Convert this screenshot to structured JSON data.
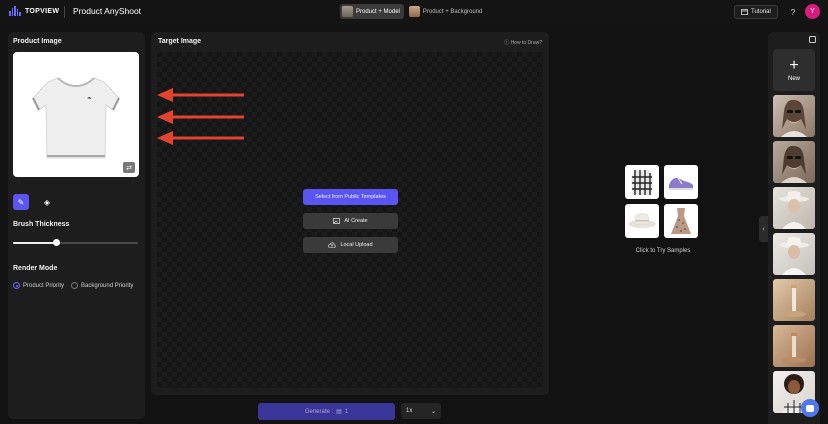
{
  "header": {
    "brand": "TOPVIEW",
    "app_title": "Product AnyShoot",
    "modes": [
      {
        "label": "Product + Model",
        "active": true
      },
      {
        "label": "Product + Background",
        "active": false
      }
    ],
    "tutorial_label": "Tutorial",
    "help_label": "?",
    "avatar_initial": "Y"
  },
  "left_panel": {
    "product_image_label": "Product Image",
    "brush_thickness_label": "Brush Thickness",
    "brush_thickness_value": 0.35,
    "render_mode_label": "Render Mode",
    "render_options": [
      {
        "label": "Product Priority",
        "selected": true
      },
      {
        "label": "Background Priority",
        "selected": false
      }
    ]
  },
  "center": {
    "target_image_label": "Target Image",
    "how_to_draw": "How to Draw?",
    "actions": {
      "templates": "Select from Public Templates",
      "ai_create": "AI Create",
      "local_upload": "Local Upload"
    }
  },
  "samples": {
    "label": "Click to Try Samples"
  },
  "footer": {
    "generate_label": "Generate :",
    "generate_cost": "1",
    "multiplier": "1x"
  },
  "right_panel": {
    "new_label": "New"
  },
  "colors": {
    "accent": "#5a55f2",
    "arrow": "#e2432f",
    "avatar": "#d81b7e"
  }
}
